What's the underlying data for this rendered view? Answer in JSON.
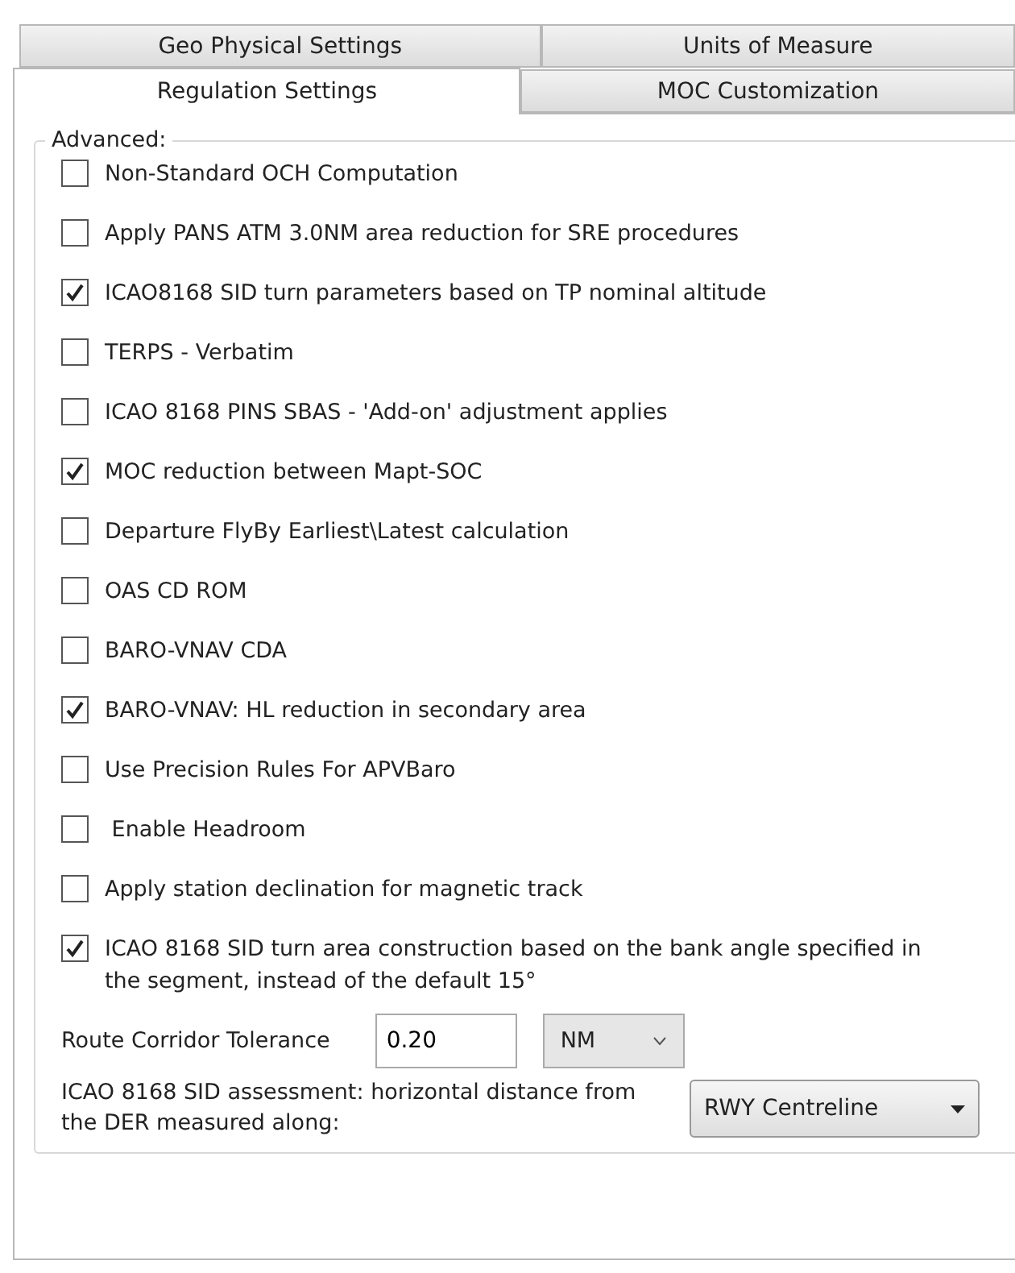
{
  "tabs_back": [
    {
      "label": "Geo Physical Settings",
      "selected": false
    },
    {
      "label": "Units of Measure",
      "selected": false
    }
  ],
  "tabs_front": [
    {
      "label": "Regulation Settings",
      "selected": true
    },
    {
      "label": "MOC Customization",
      "selected": false
    }
  ],
  "group": {
    "title": "Advanced:"
  },
  "options": [
    {
      "label": "Non-Standard OCH Computation",
      "checked": false
    },
    {
      "label": "Apply PANS ATM 3.0NM area reduction for SRE procedures",
      "checked": false
    },
    {
      "label": "ICAO8168 SID turn parameters based on TP nominal altitude",
      "checked": true
    },
    {
      "label": "TERPS - Verbatim",
      "checked": false
    },
    {
      "label": "ICAO 8168 PINS SBAS - 'Add-on' adjustment applies",
      "checked": false
    },
    {
      "label": "MOC reduction between Mapt-SOC",
      "checked": true
    },
    {
      "label": "Departure FlyBy Earliest\\Latest calculation",
      "checked": false
    },
    {
      "label": "OAS CD ROM",
      "checked": false
    },
    {
      "label": "BARO-VNAV CDA",
      "checked": false
    },
    {
      "label": "BARO-VNAV: HL reduction in secondary area",
      "checked": true
    },
    {
      "label": "Use Precision Rules For APVBaro",
      "checked": false
    },
    {
      "label": " Enable Headroom",
      "checked": false
    },
    {
      "label": "Apply station declination for magnetic track",
      "checked": false
    },
    {
      "label": "ICAO 8168 SID turn area construction based on the bank angle specified in the segment, instead of the default 15°",
      "checked": true
    }
  ],
  "route_corridor": {
    "label": "Route Corridor Tolerance",
    "value": "0.20",
    "unit": "NM"
  },
  "sid_assessment": {
    "label": "ICAO 8168 SID assessment: horizontal distance from the DER measured along:",
    "value": "RWY Centreline"
  }
}
